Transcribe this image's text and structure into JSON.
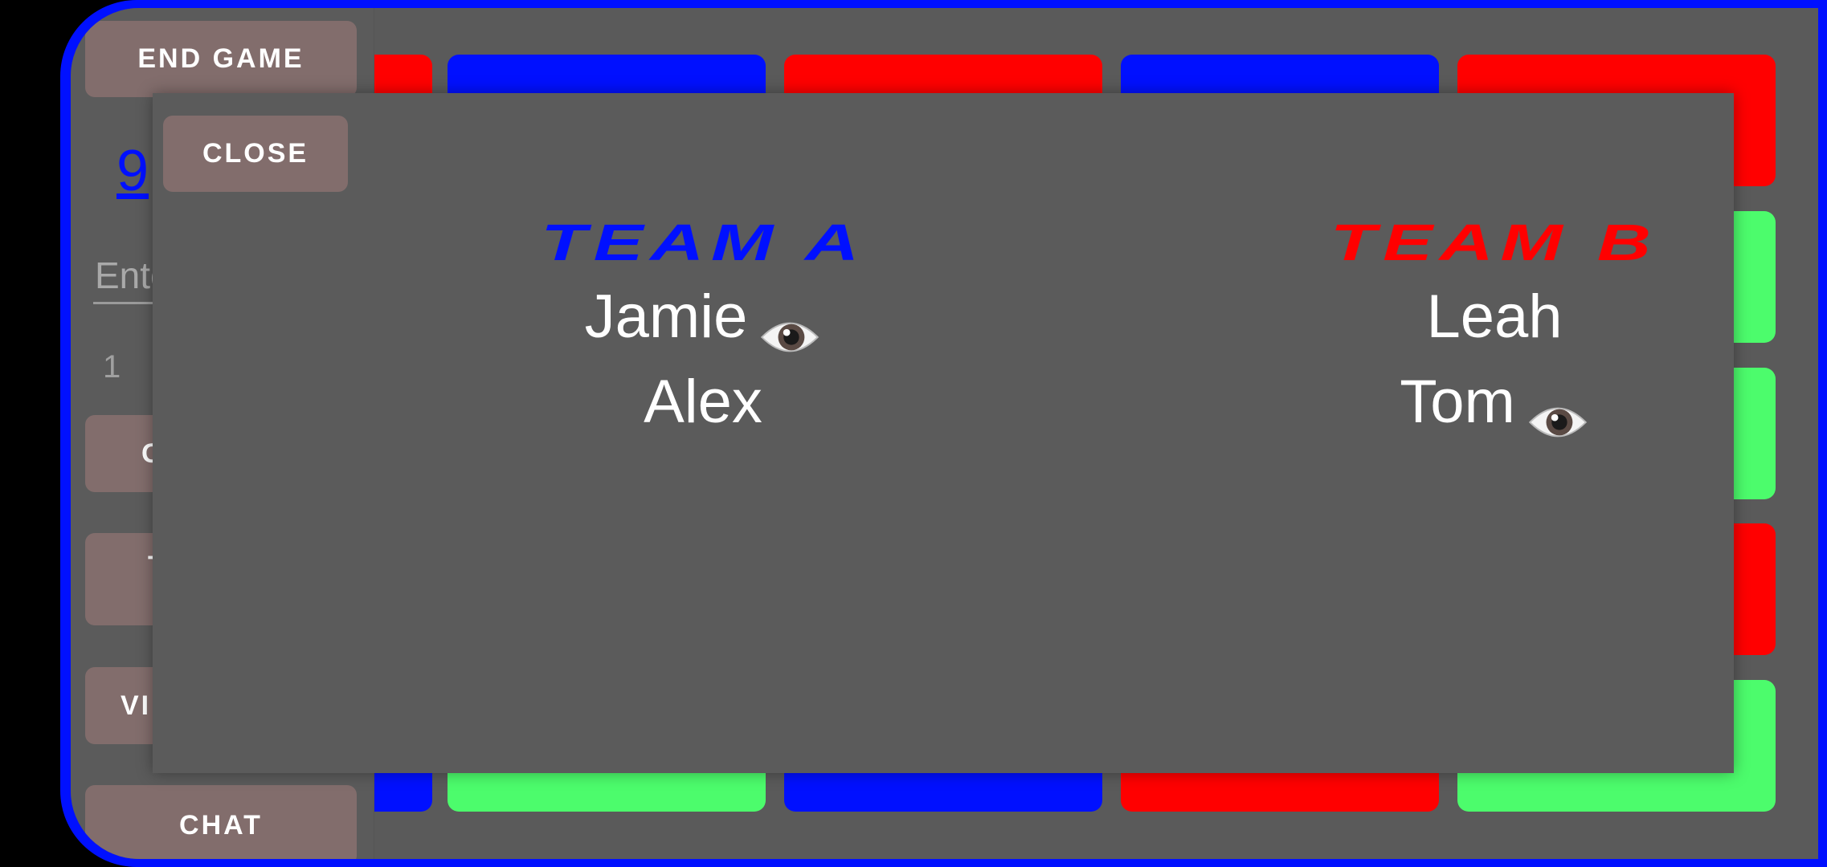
{
  "sidebar": {
    "end_game_label": "END GAME",
    "link_value": "9",
    "input_placeholder": "Enter",
    "counter_value": "1",
    "buttons_partial": [
      "G",
      "T",
      "VI"
    ],
    "chat_label": "CHAT"
  },
  "board": {
    "colors": {
      "red": "#ff0000",
      "blue": "#0010ff",
      "green": "#4cfc6c"
    },
    "top_row": [
      "red",
      "blue",
      "red",
      "blue",
      "red"
    ],
    "right_column": [
      "red",
      "green",
      "green",
      "red",
      "green"
    ],
    "bottom_row": [
      "blue",
      "green",
      "blue",
      "red",
      "green"
    ]
  },
  "modal": {
    "close_label": "CLOSE",
    "teams": [
      {
        "name": "TEAM A",
        "color": "#0010ff",
        "players": [
          {
            "name": "Jamie",
            "spymaster": true
          },
          {
            "name": "Alex",
            "spymaster": false
          }
        ]
      },
      {
        "name": "TEAM B",
        "color": "#ff0000",
        "players": [
          {
            "name": "Leah",
            "spymaster": false
          },
          {
            "name": "Tom",
            "spymaster": true
          }
        ]
      }
    ]
  }
}
